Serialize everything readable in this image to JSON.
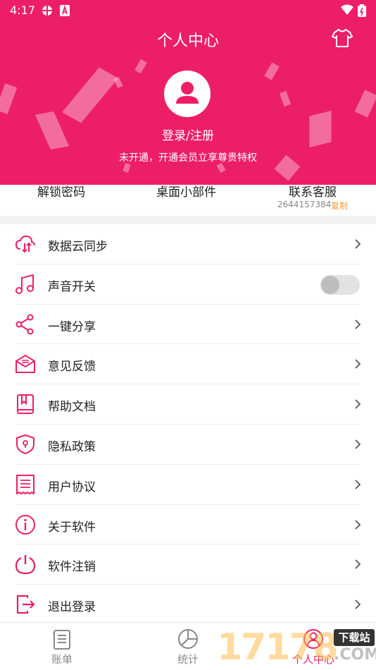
{
  "status_bar": {
    "time": "4:17"
  },
  "header": {
    "title": "个人中心",
    "login_text": "登录/注册",
    "vip_text": "未开通，开通会员立享尊贵特权"
  },
  "quick_actions": {
    "unlock_password": "解锁密码",
    "desktop_widget": "桌面小部件",
    "contact_service": "联系客服",
    "phone": "2644157384",
    "copy": "复制"
  },
  "menu": [
    {
      "label": "数据云同步",
      "icon": "cloud-sync-icon"
    },
    {
      "label": "声音开关",
      "icon": "music-note-icon",
      "toggle": false
    },
    {
      "label": "一键分享",
      "icon": "share-icon"
    },
    {
      "label": "意见反馈",
      "icon": "envelope-icon"
    },
    {
      "label": "帮助文档",
      "icon": "book-icon"
    },
    {
      "label": "隐私政策",
      "icon": "shield-icon"
    },
    {
      "label": "用户协议",
      "icon": "document-icon"
    },
    {
      "label": "关于软件",
      "icon": "info-icon"
    },
    {
      "label": "软件注销",
      "icon": "power-icon"
    },
    {
      "label": "退出登录",
      "icon": "logout-icon"
    }
  ],
  "tabs": [
    {
      "label": "账单",
      "icon": "bill-icon"
    },
    {
      "label": "统计",
      "icon": "pie-chart-icon"
    },
    {
      "label": "个人中心",
      "icon": "user-icon",
      "active": true
    }
  ],
  "watermark": {
    "number": "17178",
    "badge": "下载站",
    "domain": ".COM"
  },
  "colors": {
    "accent": "#ec1f66",
    "copy": "#f39c3b"
  }
}
